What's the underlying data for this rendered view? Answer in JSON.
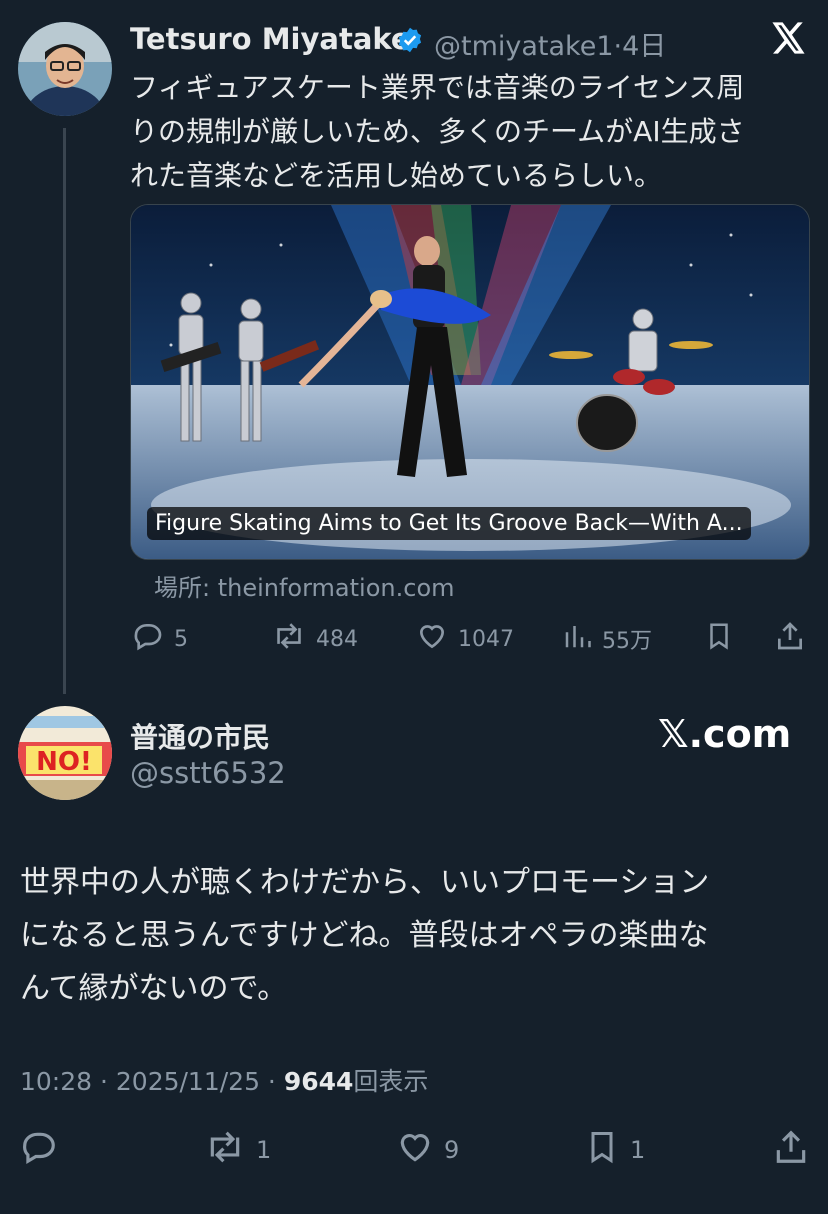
{
  "tweet1": {
    "author_name": "Tetsuro Miyatake",
    "handle": "@tmiyatake1",
    "time": "4日",
    "text_lines": [
      "フィギュアスケート業界では音楽のライセンス周",
      "りの規制が厳しいため、多くのチームがAI生成さ",
      "れた音楽などを活用し始めているらしい。"
    ],
    "card": {
      "headline": "Figure Skating Aims to Get Its Groove Back—With A...",
      "source_label": "場所: theinformation.com"
    },
    "actions": {
      "replies": "5",
      "reposts": "484",
      "likes": "1047",
      "views": "55万"
    },
    "verified_color": "#1d9bf0"
  },
  "tweet2": {
    "author_name": "普通の市民",
    "handle": "@sstt6532",
    "text_lines": [
      "世界中の人が聴くわけだから、いいプロモーション",
      "になると思うんですけどね。普段はオペラの楽曲な",
      "んて縁がないので。"
    ],
    "timestamp": "10:28 · 2025/11/25 ·",
    "views_count": "9644",
    "views_label": "回表示",
    "actions": {
      "reposts": "1",
      "likes": "9",
      "bookmarks": "1"
    },
    "avatar_text": "NO!"
  },
  "watermark": "𝕏.com",
  "colors": {
    "background": "#15202b",
    "muted": "#8b98a5",
    "accent": "#1d9bf0"
  }
}
